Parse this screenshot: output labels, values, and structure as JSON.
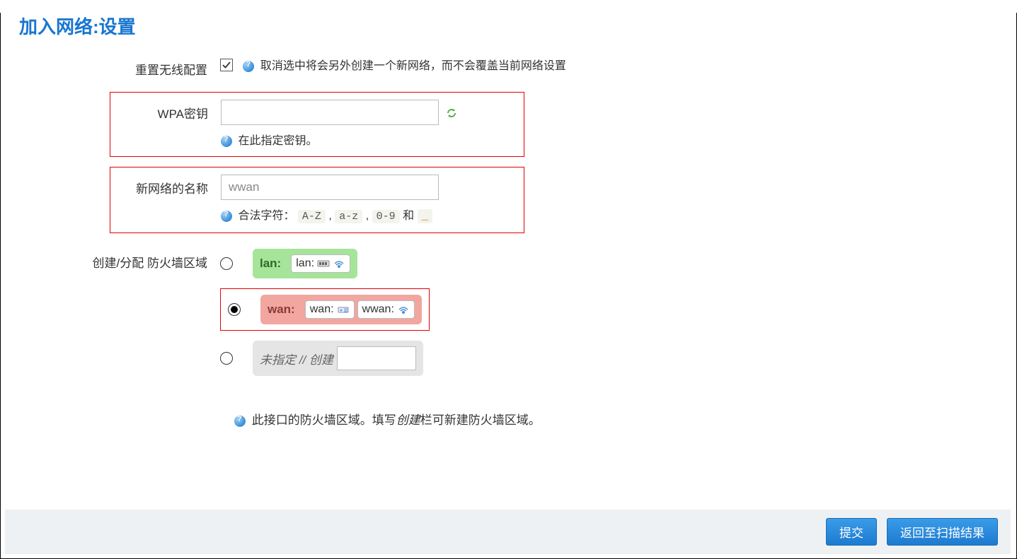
{
  "page": {
    "title": "加入网络:设置"
  },
  "reset": {
    "label": "重置无线配置",
    "checked": true,
    "hint": "取消选中将会另外创建一个新网络，而不会覆盖当前网络设置"
  },
  "wpa": {
    "label": "WPA密钥",
    "value": "",
    "hint": "在此指定密钥。"
  },
  "netname": {
    "label": "新网络的名称",
    "value": "wwan",
    "hint_prefix": "合法字符：",
    "code_AZ": "A-Z",
    "code_az": "a-z",
    "code_09": "0-9",
    "and": " 和 ",
    "underscore": "_"
  },
  "firewall": {
    "label": "创建/分配 防火墙区域",
    "zones": {
      "lan": {
        "label": "lan:",
        "ifaces": [
          {
            "name": "lan:"
          }
        ]
      },
      "wan": {
        "label": "wan:",
        "ifaces": [
          {
            "name": "wan:"
          },
          {
            "name": "wwan:"
          }
        ]
      },
      "unspec": {
        "label": "未指定 // 创建"
      }
    },
    "selected": "wan",
    "hint_pre": "此接口的防火墙区域。填写",
    "hint_em": "创建",
    "hint_post": "栏可新建防火墙区域。"
  },
  "footer": {
    "submit": "提交",
    "back": "返回至扫描结果"
  },
  "sep": " , "
}
